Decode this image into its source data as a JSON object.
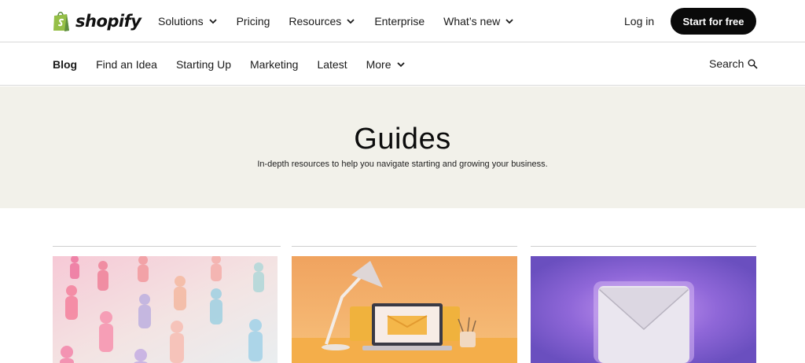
{
  "brand": {
    "name": "shopify"
  },
  "topnav": {
    "items": [
      {
        "label": "Solutions",
        "has_dropdown": true
      },
      {
        "label": "Pricing",
        "has_dropdown": false
      },
      {
        "label": "Resources",
        "has_dropdown": true
      },
      {
        "label": "Enterprise",
        "has_dropdown": false
      },
      {
        "label": "What’s new",
        "has_dropdown": true
      }
    ],
    "login_label": "Log in",
    "cta_label": "Start for free"
  },
  "blognav": {
    "items": [
      {
        "label": "Blog",
        "active": true
      },
      {
        "label": "Find an Idea"
      },
      {
        "label": "Starting Up"
      },
      {
        "label": "Marketing"
      },
      {
        "label": "Latest"
      },
      {
        "label": "More",
        "has_dropdown": true
      }
    ],
    "search_label": "Search"
  },
  "hero": {
    "title": "Guides",
    "subtitle": "In-depth resources to help you navigate starting and growing your business."
  },
  "cards": [
    {
      "image": "people-figures-illustration"
    },
    {
      "image": "laptop-lamp-email-illustration"
    },
    {
      "image": "glowing-envelope-illustration"
    }
  ],
  "colors": {
    "brand_green": "#95bf47",
    "cta_bg": "#0a0a0a",
    "hero_bg": "#f2f1ea"
  }
}
